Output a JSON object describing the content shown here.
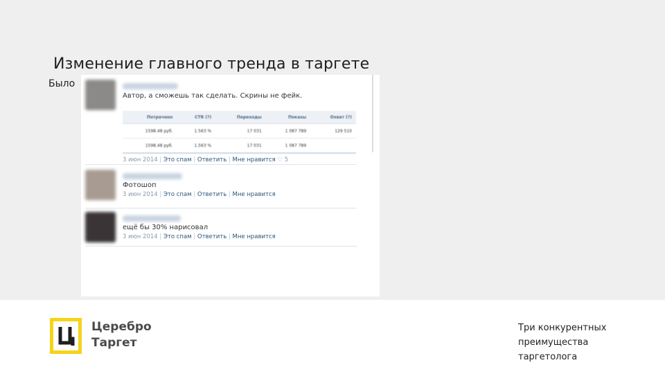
{
  "slide": {
    "title": "Изменение главного тренда в таргете",
    "before_label": "Было"
  },
  "screenshot": {
    "comments": [
      {
        "text": "Автор, а сможешь так сделать. Скрины не фейк.",
        "date": "3 июн 2014",
        "spam": "Это спам",
        "reply": "Ответить",
        "like": "Мне нравится",
        "like_count": "♡ 5",
        "avatar_color": "#8c8a88",
        "table": {
          "headers": [
            "Потрачено",
            "CTR (?)",
            "Переходы",
            "Показы",
            "Охват (?)"
          ],
          "rows": [
            [
              "1598.48 руб.",
              "1.563 %",
              "17 031",
              "1 087 789",
              "129 510"
            ],
            [
              "1598.48 руб.",
              "1.563 %",
              "17 031",
              "1 087 789",
              ""
            ]
          ]
        }
      },
      {
        "text": "Фотошоп",
        "date": "3 июн 2014",
        "spam": "Это спам",
        "reply": "Ответить",
        "like": "Мне нравится",
        "avatar_color": "#a89c92"
      },
      {
        "text": "ещё бы 30% нарисовал",
        "date": "3 июн 2014",
        "spam": "Это спам",
        "reply": "Ответить",
        "like": "Мне нравится",
        "avatar_color": "#3a3436"
      }
    ]
  },
  "brand": {
    "line1": "Церебро",
    "line2": "Таргет",
    "logo_color": "#f5d31b"
  },
  "tagline": {
    "line1": "Три конкурентных",
    "line2": "преимущества",
    "line3": "таргетолога"
  }
}
